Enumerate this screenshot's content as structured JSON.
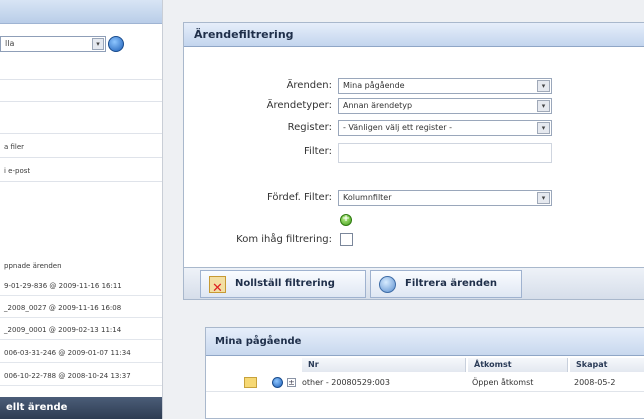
{
  "sidebar": {
    "select_value": "lla",
    "items": [
      "a filer",
      "i e-post"
    ],
    "recent_title": "ppnade ärenden",
    "recent": [
      "9-01-29-836 @ 2009-11-16 16:11",
      "_2008_0027 @ 2009-11-16 16:08",
      "_2009_0001 @ 2009-02-13 11:14",
      "006-03-31-246 @ 2009-01-07 11:34",
      "006-10-22-788 @ 2008-10-24 13:37"
    ],
    "bottom_label": "ellt ärende"
  },
  "filter_panel": {
    "title": "Ärendefiltrering",
    "rows": {
      "arenden": {
        "label": "Ärenden:",
        "value": "Mina pågående"
      },
      "arendetyper": {
        "label": "Ärendetyper:",
        "value": "Annan ärendetyp"
      },
      "register": {
        "label": "Register:",
        "value": "- Vänligen välj ett register -"
      },
      "filter": {
        "label": "Filter:",
        "value": ""
      },
      "fordef": {
        "label": "Fördef. Filter:",
        "value": "Kolumnfilter"
      },
      "remember": {
        "label": "Kom ihåg filtrering:"
      }
    },
    "dropdown_glyph": "▾",
    "add_glyph": "+",
    "buttons": {
      "reset": "Nollställ filtrering",
      "filter": "Filtrera ärenden"
    }
  },
  "grid": {
    "title": "Mina pågående",
    "columns": [
      "Nr",
      "Åtkomst",
      "Skapat"
    ],
    "rows": [
      {
        "nr": "other - 20080529:003",
        "access": "Öppen åtkomst",
        "created": "2008-05-2"
      }
    ],
    "expand_glyph": "±"
  }
}
